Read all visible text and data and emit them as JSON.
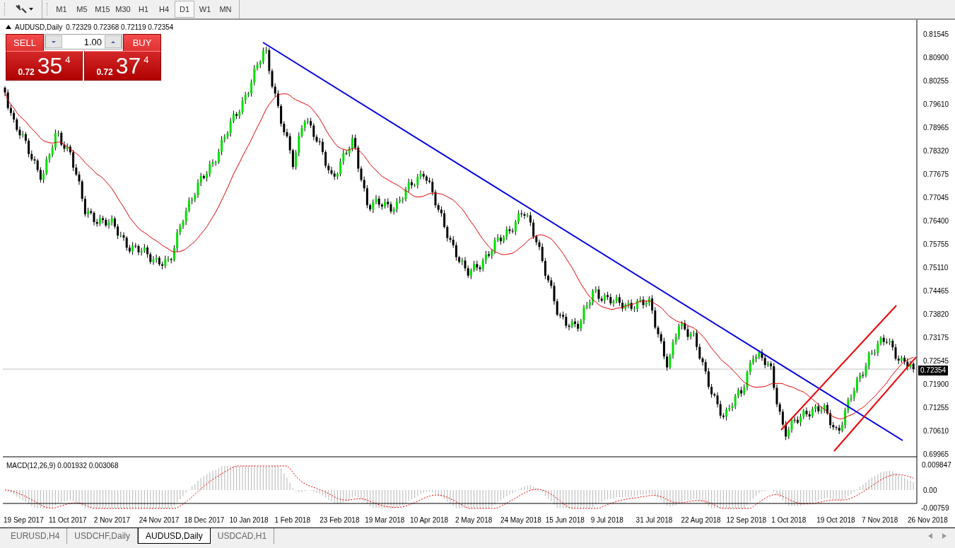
{
  "toolbar": {
    "timeframes": [
      {
        "label": "M1",
        "selected": false
      },
      {
        "label": "M5",
        "selected": false
      },
      {
        "label": "M15",
        "selected": false
      },
      {
        "label": "M30",
        "selected": false
      },
      {
        "label": "H1",
        "selected": false
      },
      {
        "label": "H4",
        "selected": false
      },
      {
        "label": "D1",
        "selected": true
      },
      {
        "label": "W1",
        "selected": false
      },
      {
        "label": "MN",
        "selected": false
      }
    ]
  },
  "chart": {
    "symbol": "AUDUSD,Daily",
    "ohlc": "0.72329 0.72368 0.72119 0.72354",
    "current_price": "0.72354",
    "price_axis": [
      "0.81545",
      "0.80900",
      "0.80255",
      "0.79610",
      "0.78965",
      "0.78320",
      "0.77675",
      "0.77045",
      "0.76400",
      "0.75755",
      "0.75110",
      "0.74465",
      "0.73820",
      "0.73175",
      "0.72545",
      "0.71900",
      "0.71255",
      "0.70610",
      "0.69965"
    ],
    "macd": {
      "label": "MACD(12,26,9) 0.001932 0.003068",
      "axis": [
        "0.009847",
        "0.00",
        "-0.00759"
      ]
    },
    "date_axis": [
      "19 Sep 2017",
      "11 Oct 2017",
      "2 Nov 2017",
      "24 Nov 2017",
      "18 Dec 2017",
      "10 Jan 2018",
      "1 Feb 2018",
      "23 Feb 2018",
      "19 Mar 2018",
      "10 Apr 2018",
      "2 May 2018",
      "24 May 2018",
      "15 Jun 2018",
      "9 Jul 2018",
      "31 Jul 2018",
      "22 Aug 2018",
      "12 Sep 2018",
      "1 Oct 2018",
      "19 Oct 2018",
      "7 Nov 2018",
      "26 Nov 2018"
    ]
  },
  "trade_panel": {
    "sell": {
      "label": "SELL",
      "prefix": "0.72",
      "big": "35",
      "sup": "4"
    },
    "buy": {
      "label": "BUY",
      "prefix": "0.72",
      "big": "37",
      "sup": "4"
    },
    "lot": "1.00"
  },
  "tabs": [
    {
      "label": "EURUSD,H4",
      "selected": false
    },
    {
      "label": "USDCHF,Daily",
      "selected": false
    },
    {
      "label": "AUDUSD,Daily",
      "selected": true
    },
    {
      "label": "USDCAD,H1",
      "selected": false
    }
  ]
}
